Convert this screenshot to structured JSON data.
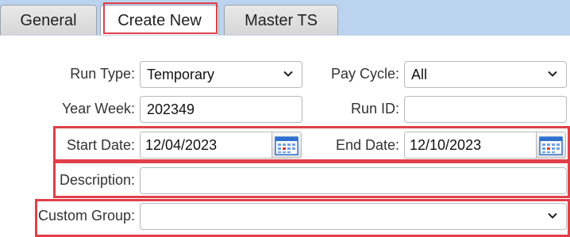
{
  "tabs": [
    {
      "label": "General"
    },
    {
      "label": "Create New"
    },
    {
      "label": "Master TS"
    }
  ],
  "form": {
    "run_type": {
      "label": "Run Type:",
      "value": "Temporary"
    },
    "pay_cycle": {
      "label": "Pay Cycle:",
      "value": "All"
    },
    "year_week": {
      "label": "Year Week:",
      "value": "202349"
    },
    "run_id": {
      "label": "Run ID:",
      "value": ""
    },
    "start_date": {
      "label": "Start Date:",
      "value": "12/04/2023"
    },
    "end_date": {
      "label": "End Date:",
      "value": "12/10/2023"
    },
    "description": {
      "label": "Description:",
      "value": ""
    },
    "custom_group": {
      "label": "Custom Group:",
      "value": ""
    }
  },
  "colors": {
    "tabbar_bg": "#bcd3ef",
    "highlight": "#e0404a",
    "calendar_accent": "#2f6fd0"
  },
  "icons": {
    "dropdown": "chevron-down-icon",
    "calendar": "calendar-icon"
  }
}
